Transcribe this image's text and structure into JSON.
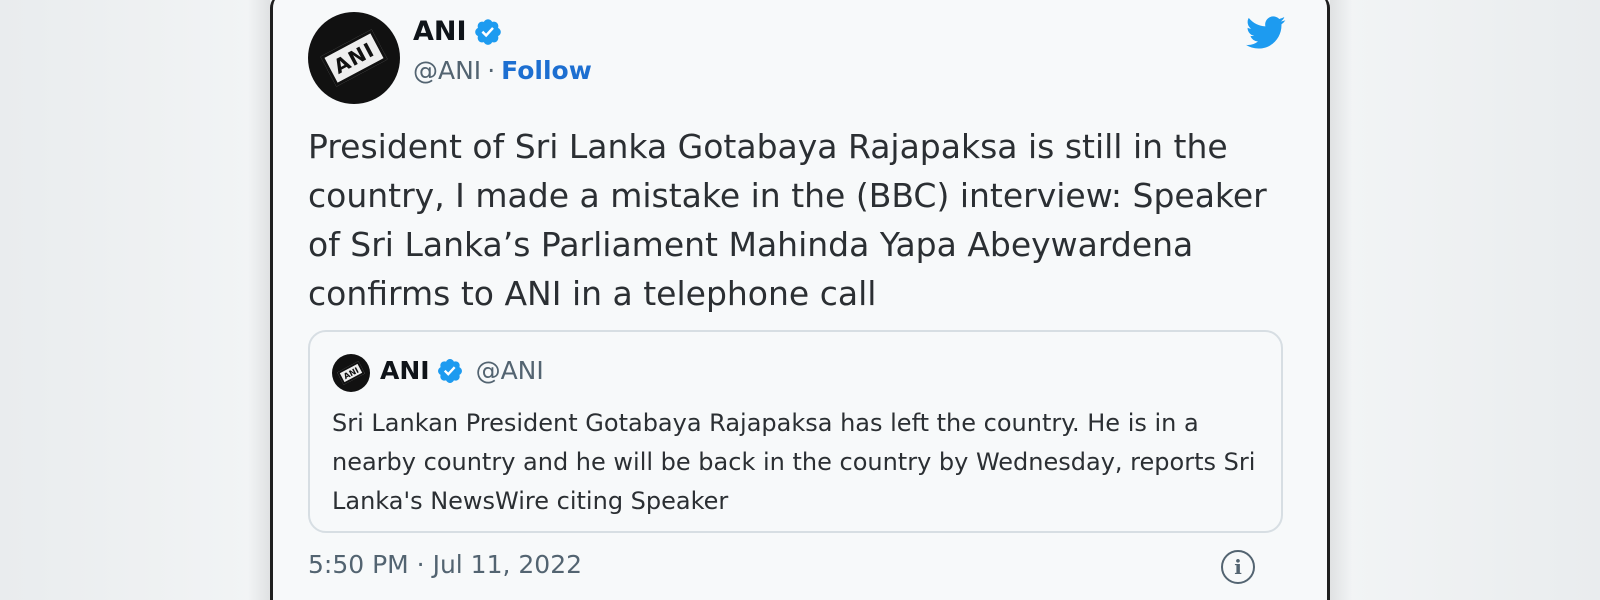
{
  "tweet": {
    "author": {
      "display_name": "ANI",
      "handle": "@ANI",
      "separator": "·",
      "follow_label": "Follow",
      "avatar_text": "ANI"
    },
    "text": "President of Sri Lanka Gotabaya Rajapaksa is still in the country, I made a mistake in the (BBC) interview: Speaker of Sri Lanka’s Parliament Mahinda Yapa Abeywardena confirms to ANI in a telephone call",
    "quoted": {
      "display_name": "ANI",
      "handle": "@ANI",
      "avatar_text": "ANI",
      "text": "Sri Lankan President Gotabaya Rajapaksa has left the country. He is in a nearby country and he will be back in the country by Wednesday, reports Sri Lanka's NewsWire citing Speaker"
    },
    "timestamp": "5:50 PM · Jul 11, 2022",
    "info_glyph": "i"
  },
  "icons": {
    "verified": "verified-badge-icon",
    "brand": "twitter-bird-icon",
    "info": "info-icon"
  },
  "colors": {
    "twitter_blue": "#1d9bf0",
    "follow_link": "#1d6fd1",
    "muted_text": "#536471",
    "body_text": "#2b2f33"
  }
}
